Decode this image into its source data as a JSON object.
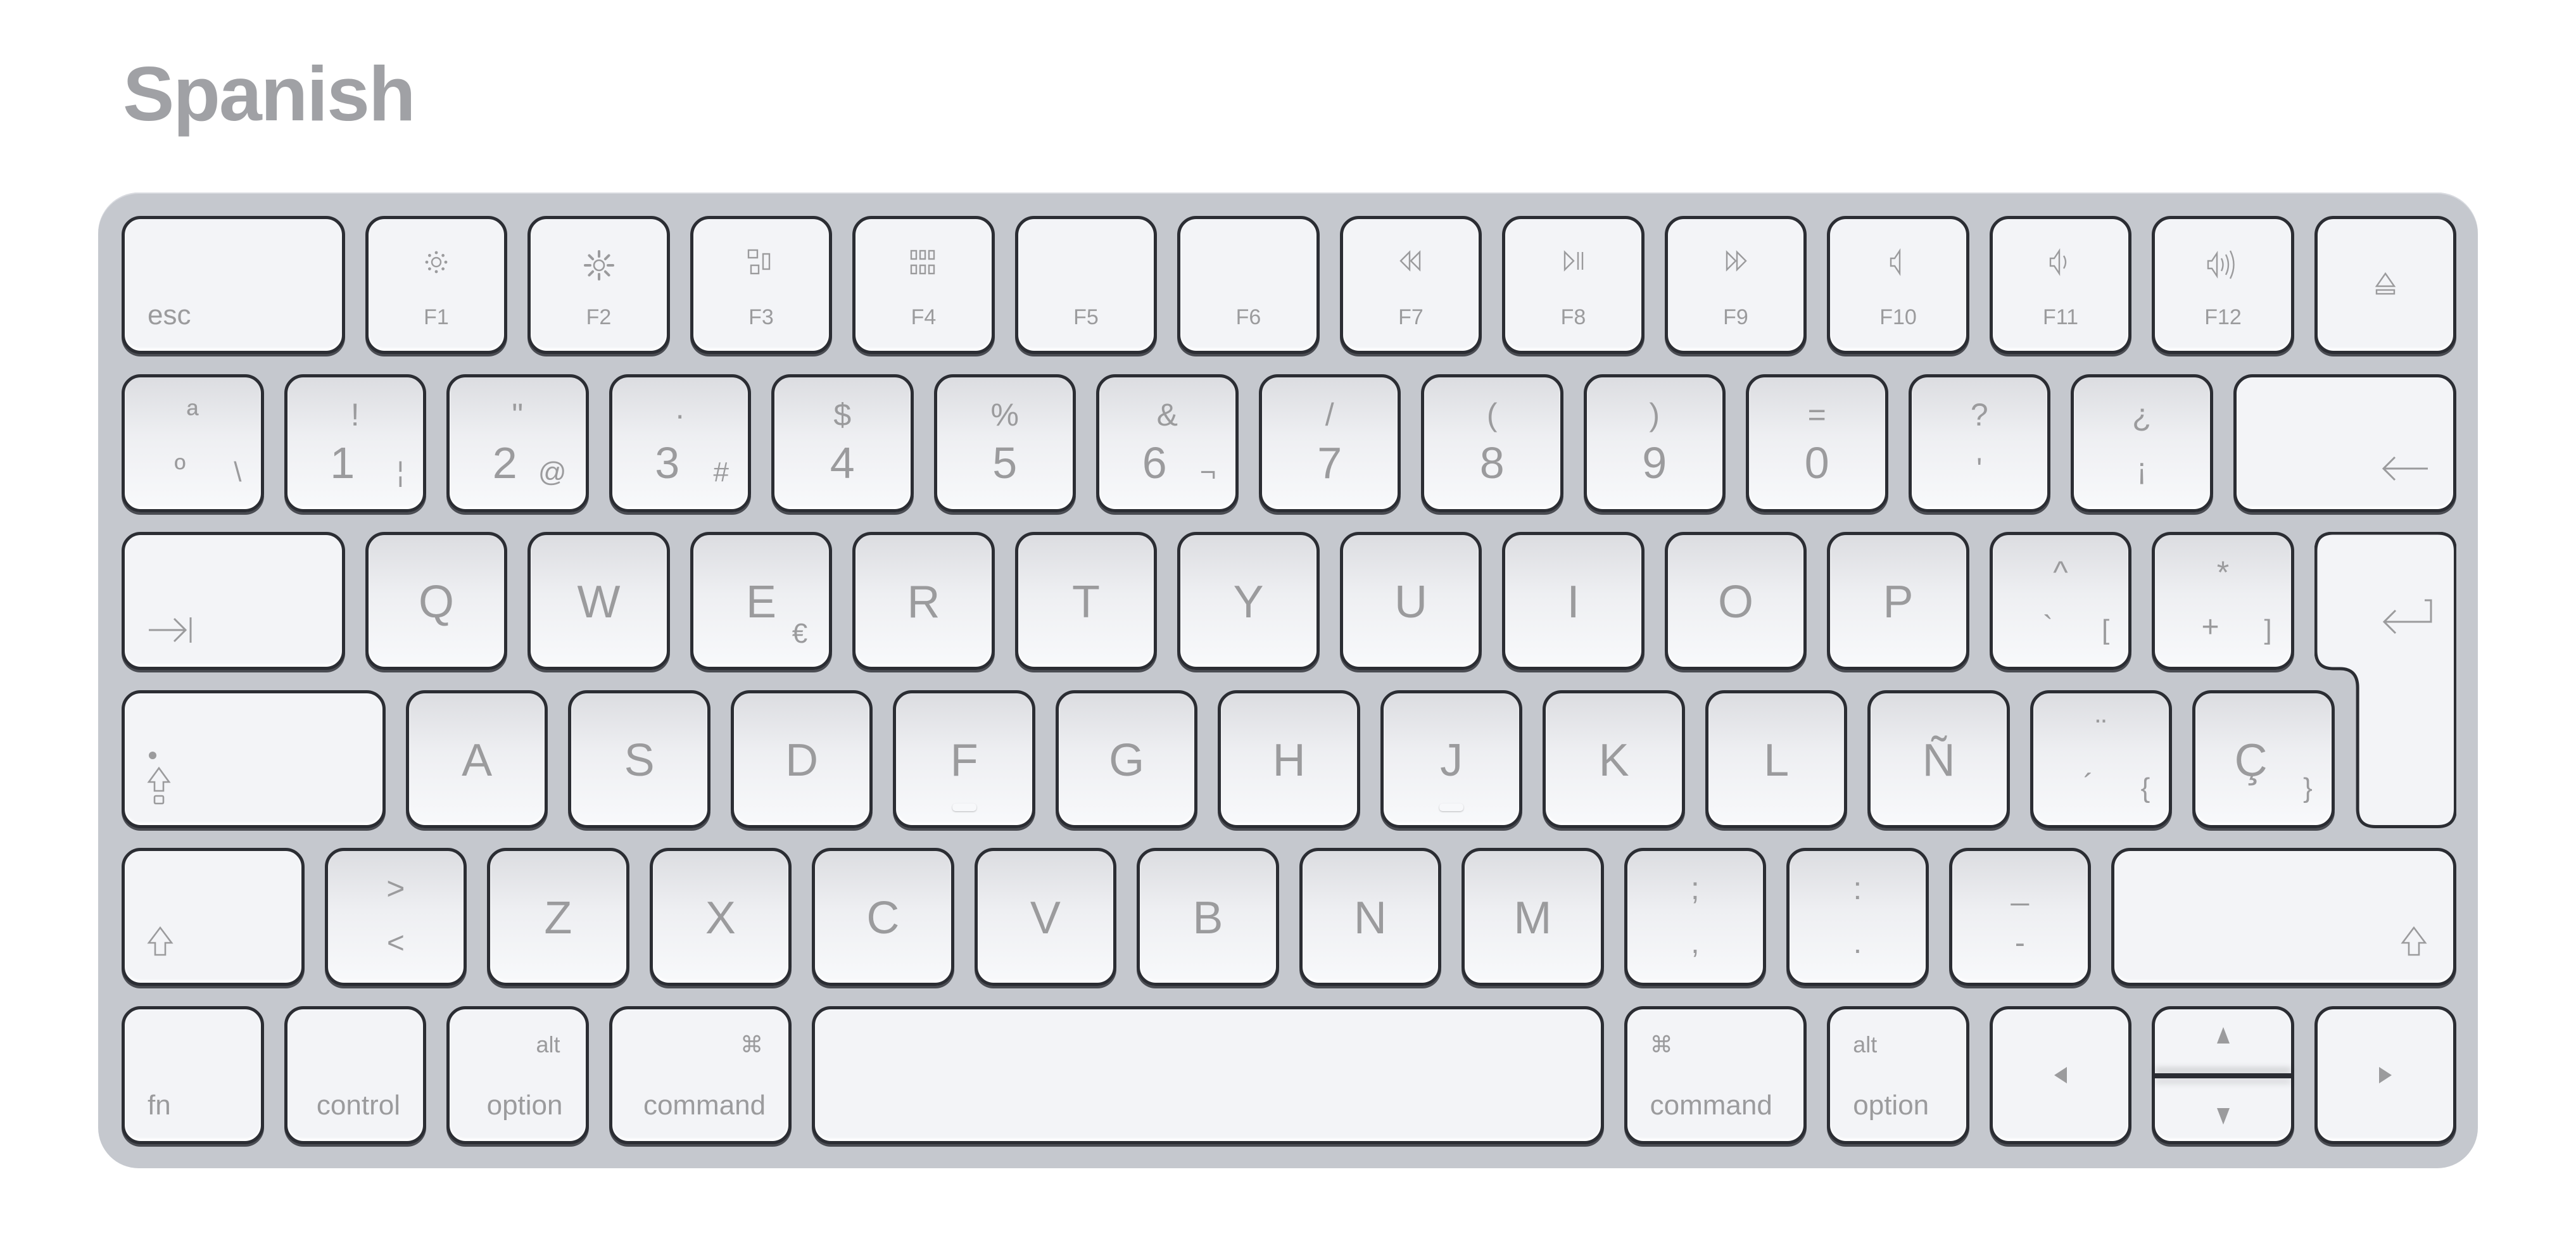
{
  "title": "Spanish",
  "keyboard": {
    "colors": {
      "frame": "#c5c8ce",
      "key_face": "#f3f4f7",
      "key_border": "#2b2d33",
      "legend": "#9b9b9d",
      "title": "#a0a1a5"
    },
    "rows": [
      [
        {
          "id": "esc",
          "bl": "esc"
        },
        {
          "id": "f1",
          "label": "F1",
          "icon": "brightness-down-icon"
        },
        {
          "id": "f2",
          "label": "F2",
          "icon": "brightness-up-icon"
        },
        {
          "id": "f3",
          "label": "F3",
          "icon": "mission-control-icon"
        },
        {
          "id": "f4",
          "label": "F4",
          "icon": "launchpad-icon"
        },
        {
          "id": "f5",
          "label": "F5"
        },
        {
          "id": "f6",
          "label": "F6"
        },
        {
          "id": "f7",
          "label": "F7",
          "icon": "rewind-icon"
        },
        {
          "id": "f8",
          "label": "F8",
          "icon": "play-pause-icon"
        },
        {
          "id": "f9",
          "label": "F9",
          "icon": "fast-forward-icon"
        },
        {
          "id": "f10",
          "label": "F10",
          "icon": "mute-icon"
        },
        {
          "id": "f11",
          "label": "F11",
          "icon": "volume-down-icon"
        },
        {
          "id": "f12",
          "label": "F12",
          "icon": "volume-up-icon"
        },
        {
          "id": "eject",
          "icon": "eject-icon"
        }
      ],
      [
        {
          "id": "ordinal",
          "top": "ª",
          "bot": "º",
          "alt": "\\"
        },
        {
          "id": "1",
          "top": "!",
          "bot": "1",
          "alt": "¦"
        },
        {
          "id": "2",
          "top": "\"",
          "bot": "2",
          "alt": "@"
        },
        {
          "id": "3",
          "top": "·",
          "bot": "3",
          "alt": "#"
        },
        {
          "id": "4",
          "top": "$",
          "bot": "4"
        },
        {
          "id": "5",
          "top": "%",
          "bot": "5"
        },
        {
          "id": "6",
          "top": "&",
          "bot": "6",
          "alt": "¬"
        },
        {
          "id": "7",
          "top": "/",
          "bot": "7"
        },
        {
          "id": "8",
          "top": "(",
          "bot": "8"
        },
        {
          "id": "9",
          "top": ")",
          "bot": "9"
        },
        {
          "id": "0",
          "top": "=",
          "bot": "0"
        },
        {
          "id": "apostrophe",
          "top": "?",
          "bot": "'"
        },
        {
          "id": "inverted-exclamation",
          "top": "¿",
          "bot": "¡"
        },
        {
          "id": "delete",
          "icon": "delete-arrow-icon"
        }
      ],
      [
        {
          "id": "tab",
          "icon": "tab-arrow-icon"
        },
        {
          "id": "q",
          "center": "Q"
        },
        {
          "id": "w",
          "center": "W"
        },
        {
          "id": "e",
          "center": "E",
          "sub": "€"
        },
        {
          "id": "r",
          "center": "R"
        },
        {
          "id": "t",
          "center": "T"
        },
        {
          "id": "y",
          "center": "Y"
        },
        {
          "id": "u",
          "center": "U"
        },
        {
          "id": "i",
          "center": "I"
        },
        {
          "id": "o",
          "center": "O"
        },
        {
          "id": "p",
          "center": "P"
        },
        {
          "id": "grave",
          "top": "^",
          "bot": "`",
          "alt": "["
        },
        {
          "id": "plus",
          "top": "*",
          "bot": "+",
          "alt": "]"
        },
        {
          "id": "return",
          "icon": "return-arrow-icon"
        }
      ],
      [
        {
          "id": "caps-lock",
          "icon": "caps-lock-icon"
        },
        {
          "id": "a",
          "center": "A"
        },
        {
          "id": "s",
          "center": "S"
        },
        {
          "id": "d",
          "center": "D"
        },
        {
          "id": "f",
          "center": "F",
          "bump": true
        },
        {
          "id": "g",
          "center": "G"
        },
        {
          "id": "h",
          "center": "H"
        },
        {
          "id": "j",
          "center": "J",
          "bump": true
        },
        {
          "id": "k",
          "center": "K"
        },
        {
          "id": "l",
          "center": "L"
        },
        {
          "id": "n-tilde",
          "center": "Ñ"
        },
        {
          "id": "acute",
          "top": "¨",
          "bot": "´",
          "alt": "{"
        },
        {
          "id": "c-cedilla",
          "center": "Ç",
          "alt": "}"
        },
        {
          "id": "return-lower",
          "icon": "input-source-icon"
        }
      ],
      [
        {
          "id": "left-shift",
          "icon": "shift-icon"
        },
        {
          "id": "angle",
          "top": ">",
          "bot": "<"
        },
        {
          "id": "z",
          "center": "Z"
        },
        {
          "id": "x",
          "center": "X"
        },
        {
          "id": "c",
          "center": "C"
        },
        {
          "id": "v",
          "center": "V"
        },
        {
          "id": "b",
          "center": "B"
        },
        {
          "id": "n",
          "center": "N"
        },
        {
          "id": "m",
          "center": "M"
        },
        {
          "id": "comma",
          "top": ";",
          "bot": ","
        },
        {
          "id": "period",
          "top": ":",
          "bot": "."
        },
        {
          "id": "minus",
          "top": "_",
          "bot": "-"
        },
        {
          "id": "right-shift",
          "icon": "shift-icon"
        }
      ],
      [
        {
          "id": "fn",
          "bl": "fn"
        },
        {
          "id": "control",
          "br": "control"
        },
        {
          "id": "left-option",
          "br": "option",
          "tr": "alt"
        },
        {
          "id": "left-command",
          "br": "command",
          "tr": "⌘"
        },
        {
          "id": "space"
        },
        {
          "id": "right-command",
          "bl": "command",
          "tl": "⌘"
        },
        {
          "id": "right-option",
          "bl": "option",
          "tl": "alt"
        },
        {
          "id": "arrow-left",
          "icon": "arrow-left-icon"
        },
        {
          "id": "arrow-up-down",
          "icon": "arrow-up-down-icon"
        },
        {
          "id": "arrow-right",
          "icon": "arrow-right-icon"
        }
      ]
    ]
  }
}
